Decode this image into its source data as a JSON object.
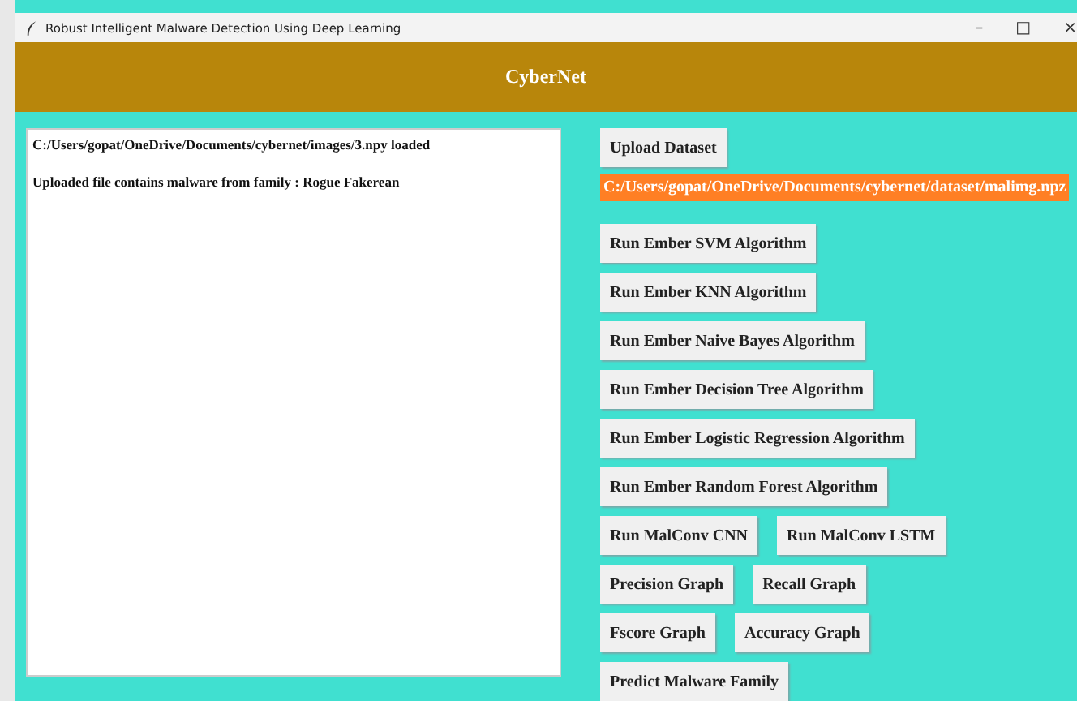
{
  "window": {
    "title": "Robust Intelligent Malware Detection Using Deep Learning",
    "controls": [
      "–",
      "□",
      "×"
    ]
  },
  "header": {
    "title": "CyberNet"
  },
  "output": {
    "lines": [
      "C:/Users/gopat/OneDrive/Documents/cybernet/images/3.npy loaded",
      "Uploaded file contains malware from family : Rogue Fakerean"
    ]
  },
  "upload_button": "Upload  Dataset",
  "dataset_path": "C:/Users/gopat/OneDrive/Documents/cybernet/dataset/malimg.npz",
  "button_rows": [
    [
      "Run Ember SVM Algorithm"
    ],
    [
      "Run Ember KNN Algorithm"
    ],
    [
      "Run Ember Naive Bayes Algorithm"
    ],
    [
      "Run Ember Decision Tree Algorithm"
    ],
    [
      "Run Ember Logistic Regression Algorithm"
    ],
    [
      "Run Ember Random Forest Algorithm"
    ],
    [
      "Run MalConv CNN",
      "Run MalConv LSTM"
    ],
    [
      "Precision Graph",
      "Recall Graph"
    ],
    [
      "Fscore Graph",
      "Accuracy Graph"
    ],
    [
      "Predict Malware Family"
    ]
  ]
}
